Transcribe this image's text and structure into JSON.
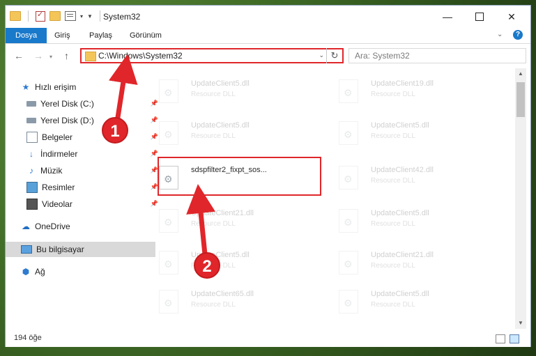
{
  "titlebar": {
    "title": "System32",
    "minimize_icon": "minimize-icon",
    "maximize_icon": "maximize-icon",
    "close_glyph": "✕"
  },
  "ribbon": {
    "tabs": [
      {
        "label": "Dosya"
      },
      {
        "label": "Giriş"
      },
      {
        "label": "Paylaş"
      },
      {
        "label": "Görünüm"
      }
    ],
    "help": "?"
  },
  "nav": {
    "back": "←",
    "forward": "→",
    "recent": "▾",
    "up": "↑",
    "address": "C:\\Windows\\System32",
    "refresh": "↻",
    "search_placeholder": "Ara: System32"
  },
  "sidebar": {
    "items": [
      {
        "label": "Hızlı erişim",
        "icon": "star-icon"
      },
      {
        "label": "Yerel Disk (C:)",
        "icon": "disk-icon",
        "pinned": true
      },
      {
        "label": "Yerel Disk (D:)",
        "icon": "disk-icon",
        "pinned": true
      },
      {
        "label": "Belgeler",
        "icon": "document-icon",
        "pinned": true
      },
      {
        "label": "İndirmeler",
        "icon": "download-icon",
        "pinned": true
      },
      {
        "label": "Müzik",
        "icon": "music-icon",
        "pinned": true
      },
      {
        "label": "Resimler",
        "icon": "pictures-icon",
        "pinned": true
      },
      {
        "label": "Videolar",
        "icon": "videos-icon",
        "pinned": true
      },
      {
        "label": "OneDrive",
        "icon": "onedrive-icon"
      },
      {
        "label": "Bu bilgisayar",
        "icon": "computer-icon"
      },
      {
        "label": "Ağ",
        "icon": "network-icon"
      }
    ]
  },
  "files": {
    "left": [
      {
        "name": "UpdateClient5.dll",
        "type": "Resource DLL"
      },
      {
        "name": "UpdateClient5.dll",
        "type": "Resource DLL"
      },
      {
        "name": "sdspfilter2_fixpt_sos...",
        "type": ""
      },
      {
        "name": "UpdateClient21.dll",
        "type": "Resource DLL"
      },
      {
        "name": "UpdateClient5.dll",
        "type": "Resource DLL"
      },
      {
        "name": "UpdateClient65.dll",
        "type": "Resource DLL"
      }
    ],
    "right": [
      {
        "name": "UpdateClient19.dll",
        "type": "Resource DLL"
      },
      {
        "name": "UpdateClient5.dll",
        "type": "Resource DLL"
      },
      {
        "name": "UpdateClient42.dll",
        "type": "Resource DLL"
      },
      {
        "name": "UpdateClient5.dll",
        "type": "Resource DLL"
      },
      {
        "name": "UpdateClient21.dll",
        "type": "Resource DLL"
      },
      {
        "name": "UpdateClient5.dll",
        "type": "Resource DLL"
      }
    ]
  },
  "status": {
    "item_count": "194 öğe"
  },
  "annotations": {
    "badge1": "1",
    "badge2": "2",
    "accent": "#e0262a"
  }
}
